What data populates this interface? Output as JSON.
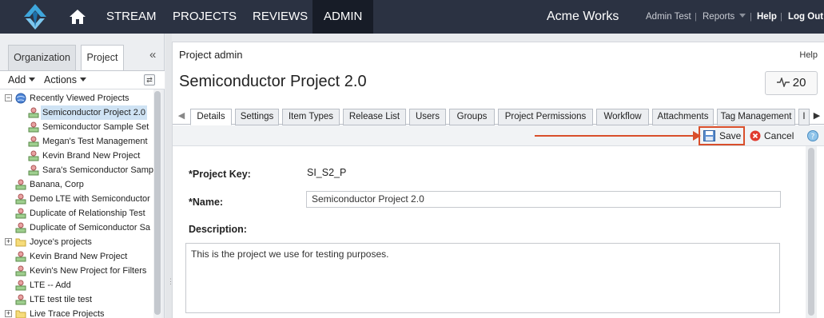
{
  "topbar": {
    "nav": [
      "STREAM",
      "PROJECTS",
      "REVIEWS",
      "ADMIN"
    ],
    "active": "ADMIN",
    "brand": "Acme Works",
    "user": "Admin Test",
    "reports": "Reports",
    "help": "Help",
    "logout": "Log Out",
    "separator": "|"
  },
  "sidebar": {
    "tabs": [
      "Organization",
      "Project"
    ],
    "active_tab": "Project",
    "add_label": "Add",
    "actions_label": "Actions",
    "tree": [
      {
        "label": "Recently Viewed Projects",
        "icon": "globe-icon"
      },
      {
        "label": "Semiconductor Project 2.0",
        "icon": "project-icon",
        "selected": true
      },
      {
        "label": "Semiconductor Sample Set",
        "icon": "project-icon"
      },
      {
        "label": "Megan's Test Management",
        "icon": "project-icon"
      },
      {
        "label": "Kevin Brand New Project",
        "icon": "project-icon"
      },
      {
        "label": "Sara's Semiconductor Samp",
        "icon": "project-icon"
      },
      {
        "label": "Banana, Corp",
        "icon": "project-icon"
      },
      {
        "label": "Demo LTE with Semiconductor",
        "icon": "project-icon"
      },
      {
        "label": "Duplicate of Relationship Test",
        "icon": "project-icon"
      },
      {
        "label": "Duplicate of Semiconductor Sa",
        "icon": "project-icon"
      },
      {
        "label": "Joyce's projects",
        "icon": "folder-icon"
      },
      {
        "label": "Kevin Brand New Project",
        "icon": "project-icon"
      },
      {
        "label": "Kevin's New Project for Filters",
        "icon": "project-icon"
      },
      {
        "label": "LTE -- Add",
        "icon": "project-icon"
      },
      {
        "label": "LTE test tile test",
        "icon": "project-icon"
      },
      {
        "label": "Live Trace Projects",
        "icon": "folder-icon"
      }
    ]
  },
  "main": {
    "section_title": "Project admin",
    "help": "Help",
    "project_title": "Semiconductor Project 2.0",
    "activity_count": "20",
    "tabs": [
      "Details",
      "Settings",
      "Item Types",
      "Release List",
      "Users",
      "Groups",
      "Project Permissions",
      "Workflow",
      "Attachments",
      "Tag Management",
      "I"
    ],
    "active_tab": "Details",
    "save": "Save",
    "cancel": "Cancel",
    "form": {
      "key_label": "*Project Key:",
      "key_value": "SI_S2_P",
      "name_label": "*Name:",
      "name_value": "Semiconductor Project 2.0",
      "desc_label": "Description:",
      "desc_value": "This is the project we use for testing purposes."
    }
  },
  "colors": {
    "topbar": "#2b3242",
    "highlight": "#d94f2b",
    "selection": "#cfe3f4"
  }
}
